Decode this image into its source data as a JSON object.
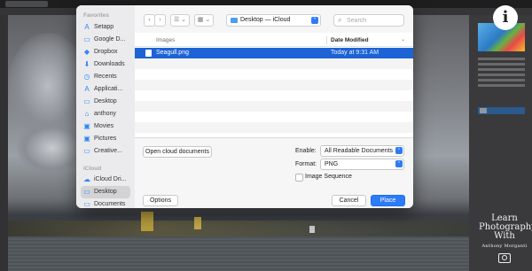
{
  "dialog": {
    "sidebar": {
      "favorites_heading": "Favorites",
      "icloud_heading": "iCloud",
      "favorites": [
        {
          "label": "Setapp",
          "icon": "A"
        },
        {
          "label": "Google D...",
          "icon": "▭"
        },
        {
          "label": "Dropbox",
          "icon": "◆"
        },
        {
          "label": "Downloads",
          "icon": "⬇"
        },
        {
          "label": "Recents",
          "icon": "◷"
        },
        {
          "label": "Applicati...",
          "icon": "A"
        },
        {
          "label": "Desktop",
          "icon": "▭"
        },
        {
          "label": "anthony",
          "icon": "⌂"
        },
        {
          "label": "Movies",
          "icon": "▣"
        },
        {
          "label": "Pictures",
          "icon": "▣"
        },
        {
          "label": "Creative...",
          "icon": "▭"
        }
      ],
      "icloud": [
        {
          "label": "iCloud Dri...",
          "icon": "☁"
        },
        {
          "label": "Desktop",
          "icon": "▭",
          "selected": true
        },
        {
          "label": "Documents",
          "icon": "▭"
        }
      ]
    },
    "toolbar": {
      "back_icon": "‹",
      "forward_icon": "›",
      "list_view_icon": "☰ ⌄",
      "grid_view_icon": "▦ ⌄",
      "location": "Desktop — iCloud",
      "location_arrow": "⌃",
      "search_placeholder": "Search",
      "search_value": ""
    },
    "file_list": {
      "columns": [
        "Images",
        "Date Modified"
      ],
      "sort_chevron": "⌄",
      "rows": [
        {
          "name": "Seagull.png",
          "date": "Today at 9:31 AM",
          "selected": true
        }
      ]
    },
    "bottom": {
      "open_cloud_label": "Open cloud documents",
      "enable_label": "Enable:",
      "enable_value": "All Readable Documents",
      "format_label": "Format:",
      "format_value": "PNG",
      "image_sequence_label": "Image Sequence",
      "image_sequence_checked": false,
      "options_label": "Options",
      "cancel_label": "Cancel",
      "place_label": "Place",
      "select_arrow": "⌃"
    }
  },
  "overlay": {
    "info_badge": "i",
    "watermark_lines": [
      "Learn",
      "Photography",
      "With"
    ],
    "watermark_name": "Anthony Morganti"
  },
  "colors": {
    "accent": "#2d7cf6",
    "selection": "#1d63d6",
    "sidebar_icon": "#2f86f6"
  }
}
